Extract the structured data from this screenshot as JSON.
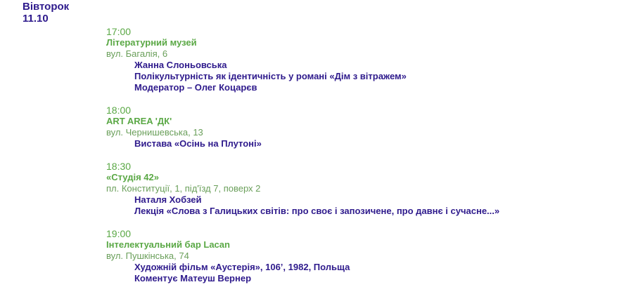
{
  "day": {
    "weekday": "Вівторок",
    "date": "11.10"
  },
  "events": [
    {
      "time": "17:00",
      "venue": "Літературний музей",
      "address": "вул. Багалія, 6",
      "lines": [
        "Жанна Слоньовська",
        "Полікультурність як ідентичність у романі «Дім з вітражем»",
        "Модератор – Олег Коцарєв"
      ]
    },
    {
      "time": "18:00",
      "venue": "ART AREA 'ДК'",
      "address": "вул. Чернишевська, 13",
      "lines": [
        "Вистава «Осінь на Плутоні»"
      ]
    },
    {
      "time": "18:30",
      "venue": "«Студія 42»",
      "address": "пл. Конституції, 1, під'їзд 7, поверх 2",
      "lines": [
        "Наталя Хобзей",
        "Лекція «Слова з Галицьких світів: про своє і запозичене, про давнє і сучасне...»"
      ]
    },
    {
      "time": "19:00",
      "venue": "Інтелектуальний бар Lacan",
      "address": "вул. Пушкінська, 74",
      "lines": [
        "Художній фільм «Аустерія», 106’, 1982, Польща",
        "Коментує Матеуш Вернер"
      ]
    }
  ]
}
